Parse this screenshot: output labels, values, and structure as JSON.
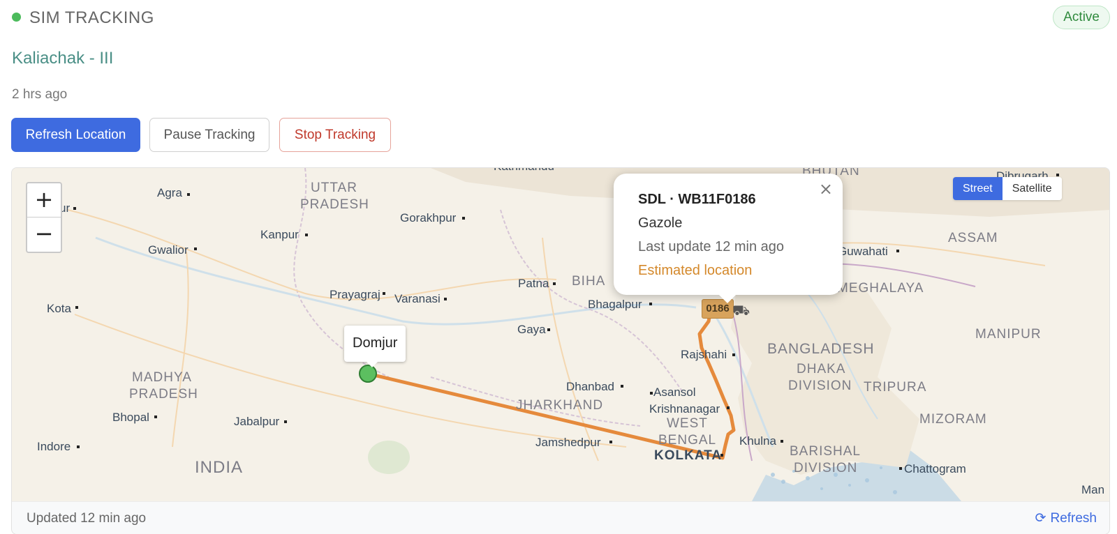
{
  "header": {
    "title": "SIM TRACKING",
    "status_badge": "Active",
    "status_color": "#4cbb5c"
  },
  "sim": {
    "name": "Kaliachak - III",
    "time_ago": "2 hrs ago"
  },
  "actions": {
    "refresh_label": "Refresh Location",
    "pause_label": "Pause Tracking",
    "stop_label": "Stop Tracking"
  },
  "map": {
    "zoom_in": "+",
    "zoom_out": "−",
    "layers": {
      "street": "Street",
      "satellite": "Satellite",
      "selected": "Street"
    },
    "popup": {
      "title": "SDL · WB11F0186",
      "place": "Gazole",
      "last_update": "Last update 12 min ago",
      "estimated": "Estimated location",
      "close": "×"
    },
    "origin_tooltip": "Domjur",
    "vehicle_plate": "0186",
    "route_color": "#e58a3c",
    "origin_marker_color": "#5cbf60",
    "labels": {
      "agra": "Agra",
      "uttar": "UTTAR",
      "pradesh": "PRADESH",
      "kathmandu": "Kathmandu",
      "bhutan": "BHUTAN",
      "dibrugarh": "Dibrugarh",
      "gorakhpur": "Gorakhpur",
      "kanpur": "Kanpur",
      "gwalior": "Gwalior",
      "guwahati": "Guwahati",
      "assam": "ASSAM",
      "patna": "Patna",
      "bihar": "BIHA",
      "prayagraj": "Prayagraj",
      "varanasi": "Varanasi",
      "meghalaya": "MEGHALAYA",
      "division": "DIVISION",
      "kota": "Kota",
      "bhagalpur": "Bhagalpur",
      "gaya": "Gaya",
      "manipur": "MANIPUR",
      "bangladesh": "BANGLADESH",
      "rajshahi": "Rajshahi",
      "dhaka": "DHAKA",
      "dhaka_division": "DIVISION",
      "tripura": "TRIPURA",
      "madhya": "MADHYA",
      "madhya_pradesh": "PRADESH",
      "dhanbad": "Dhanbad",
      "asansol": "Asansol",
      "jharkhand": "JHARKHAND",
      "krishnanagar": "Krishnanagar",
      "bhopal": "Bhopal",
      "jabalpur": "Jabalpur",
      "west": "WEST",
      "bengal": "BENGAL",
      "mizoram": "MIZORAM",
      "indore": "Indore",
      "jamshedpur": "Jamshedpur",
      "khulna": "Khulna",
      "barishal": "BARISHAL",
      "barishal_division": "DIVISION",
      "kolkata": "KOLKATA",
      "chattogram": "Chattogram",
      "india": "INDIA",
      "ur": "ur",
      "man": "Man"
    }
  },
  "footer": {
    "updated": "Updated 12 min ago",
    "refresh": "Refresh"
  }
}
